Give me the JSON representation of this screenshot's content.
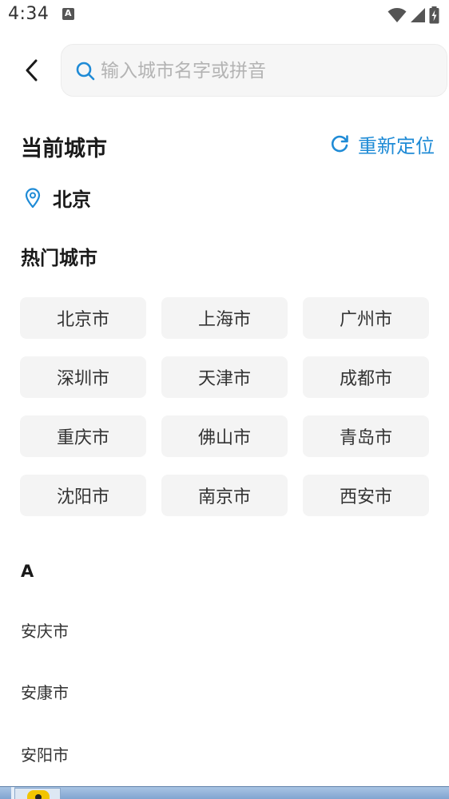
{
  "status_bar": {
    "time": "4:34",
    "icons": [
      "notification-a-icon",
      "wifi-icon",
      "signal-icon",
      "battery-charging-icon"
    ]
  },
  "header": {
    "back_icon": "chevron-left-icon",
    "search_icon": "search-icon",
    "search_placeholder": "输入城市名字或拼音",
    "search_value": ""
  },
  "current_city_section": {
    "title": "当前城市",
    "relocate_label": "重新定位",
    "relocate_icon": "refresh-icon",
    "location_icon": "location-pin-icon",
    "city": "北京"
  },
  "hot_cities": {
    "title": "热门城市",
    "items": [
      "北京市",
      "上海市",
      "广州市",
      "深圳市",
      "天津市",
      "成都市",
      "重庆市",
      "佛山市",
      "青岛市",
      "沈阳市",
      "南京市",
      "西安市"
    ]
  },
  "city_index": {
    "letter": "A",
    "cities": [
      "安庆市",
      "安康市",
      "安阳市"
    ]
  },
  "colors": {
    "accent": "#1f8bd6",
    "chip_bg": "#f4f4f4",
    "search_bg": "#f6f6f6",
    "text_primary": "#1a1a1a",
    "text_secondary": "#333333",
    "placeholder": "#b3b3b3"
  }
}
